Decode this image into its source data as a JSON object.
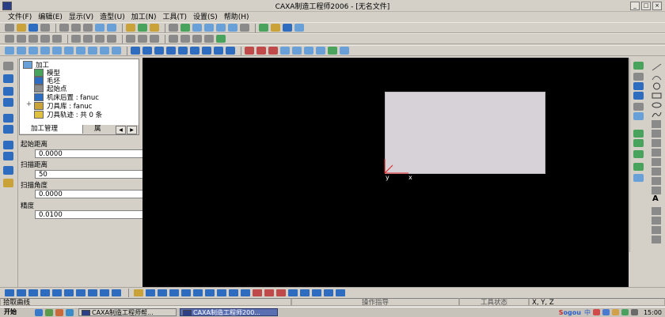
{
  "window": {
    "title": "CAXA制造工程师2006 - [无名文件]",
    "controls": [
      "_",
      "□",
      "×"
    ]
  },
  "menu": [
    "文件(F)",
    "编辑(E)",
    "显示(V)",
    "造型(U)",
    "加工(N)",
    "工具(T)",
    "设置(S)",
    "帮助(H)"
  ],
  "tree": {
    "root": "加工",
    "items": [
      "模型",
      "毛坯",
      "起始点",
      "机床后置 : fanuc",
      "刀具库 : fanuc",
      "刀具轨迹 : 共 0 条"
    ],
    "tabs": [
      "加工管理",
      "属"
    ]
  },
  "params": {
    "fields": [
      {
        "label": "起始距离",
        "value": "0.0000"
      },
      {
        "label": "扫描距离",
        "value": "50"
      },
      {
        "label": "扫描角度",
        "value": "0.0000"
      },
      {
        "label": "精度",
        "value": "0.0100"
      }
    ]
  },
  "canvas": {
    "background": "#000000",
    "blank_color": "#d7d2d7",
    "axis_x": "x",
    "axis_y": "y"
  },
  "status": {
    "prompt": "拾取曲线",
    "command": "操作指导",
    "tool_state": "工具状态",
    "coords": "X, Y, Z"
  },
  "taskbar": {
    "start": "开始",
    "tasks": [
      "CAXA制造工程师帮...",
      "CAXA制造工程师200..."
    ],
    "ime_logo_s": "S",
    "ime_logo_rest": "ogou",
    "ime_mode": "中",
    "clock": "15:00"
  }
}
